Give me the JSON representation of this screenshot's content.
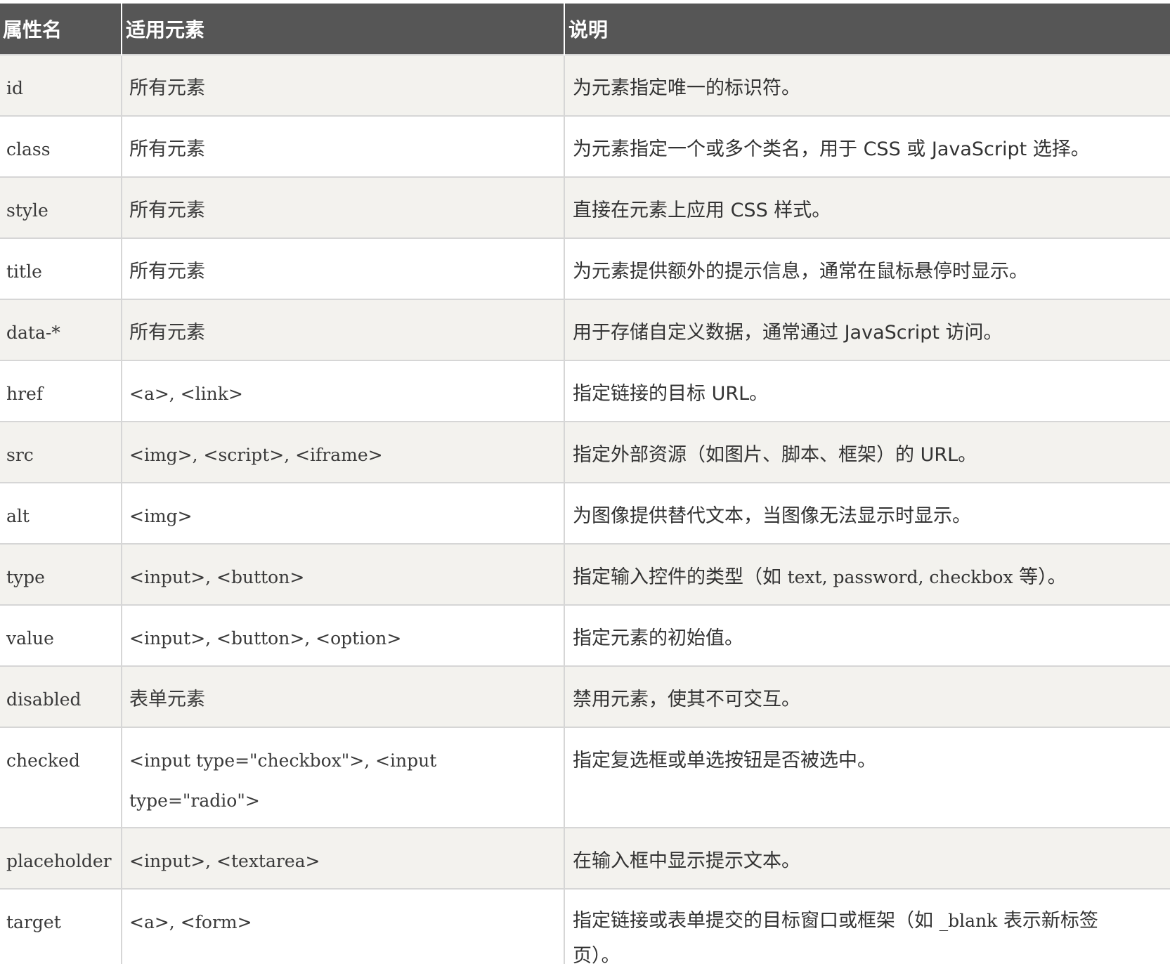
{
  "table": {
    "headers": {
      "name": "属性名",
      "elements": "适用元素",
      "description": "说明"
    },
    "rows": [
      {
        "name": "id",
        "elements": "所有元素",
        "elements_cjk": true,
        "description": "为元素指定唯一的标识符。"
      },
      {
        "name": "class",
        "elements": "所有元素",
        "elements_cjk": true,
        "description": "为元素指定一个或多个类名，用于 CSS 或 JavaScript 选择。"
      },
      {
        "name": "style",
        "elements": "所有元素",
        "elements_cjk": true,
        "description": "直接在元素上应用 CSS 样式。"
      },
      {
        "name": "title",
        "elements": "所有元素",
        "elements_cjk": true,
        "description": "为元素提供额外的提示信息，通常在鼠标悬停时显示。"
      },
      {
        "name": "data-*",
        "elements": "所有元素",
        "elements_cjk": true,
        "description": "用于存储自定义数据，通常通过 JavaScript 访问。"
      },
      {
        "name": "href",
        "elements": "<a>, <link>",
        "elements_cjk": false,
        "description": "指定链接的目标 URL。"
      },
      {
        "name": "src",
        "elements": "<img>, <script>, <iframe>",
        "elements_cjk": false,
        "description": "指定外部资源（如图片、脚本、框架）的 URL。"
      },
      {
        "name": "alt",
        "elements": "<img>",
        "elements_cjk": false,
        "description": "为图像提供替代文本，当图像无法显示时显示。"
      },
      {
        "name": "type",
        "elements": "<input>, <button>",
        "elements_cjk": false,
        "description_parts": [
          "指定输入控件的类型（如 ",
          "text, password, checkbox",
          " 等）。"
        ]
      },
      {
        "name": "value",
        "elements": "<input>, <button>, <option>",
        "elements_cjk": false,
        "description": "指定元素的初始值。"
      },
      {
        "name": "disabled",
        "elements": "表单元素",
        "elements_cjk": true,
        "description": "禁用元素，使其不可交互。"
      },
      {
        "name": "checked",
        "elements": "<input type=\"checkbox\">, <input type=\"radio\">",
        "elements_cjk": false,
        "description": "指定复选框或单选按钮是否被选中。"
      },
      {
        "name": "placeholder",
        "elements": "<input>, <textarea>",
        "elements_cjk": false,
        "description": "在输入框中显示提示文本。"
      },
      {
        "name": "target",
        "elements": "<a>, <form>",
        "elements_cjk": false,
        "description_parts": [
          "指定链接或表单提交的目标窗口或框架（如 ",
          "_blank",
          " 表示新标签页）。"
        ]
      }
    ]
  }
}
